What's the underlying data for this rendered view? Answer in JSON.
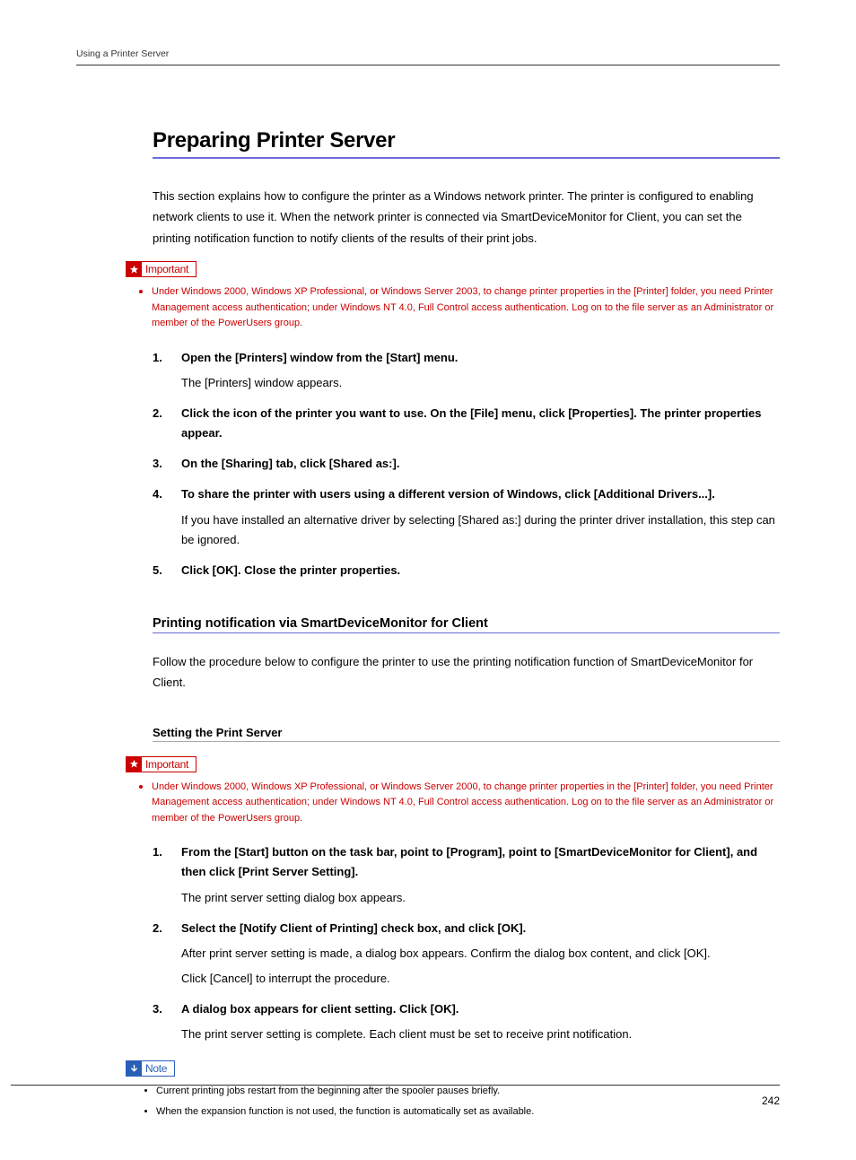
{
  "running_head": "Using a Printer Server",
  "page_number": "242",
  "title": "Preparing Printer Server",
  "intro": "This section explains how to configure the printer as a Windows network printer. The printer is configured to enabling network clients to use it. When the network printer is connected via SmartDeviceMonitor for Client, you can set the printing notification function to notify clients of the results of their print jobs.",
  "important_label": "Important",
  "note_label": "Note",
  "important1_text": "Under Windows 2000, Windows XP Professional, or Windows Server 2003, to change printer properties in the [Printer] folder, you need Printer Management access authentication; under Windows NT 4.0, Full Control access authentication. Log on to the file server as an Administrator or member of the PowerUsers group.",
  "steps1": [
    {
      "bold": "Open the [Printers] window from the [Start] menu.",
      "desc": "The [Printers] window appears."
    },
    {
      "bold": "Click the icon of the printer you want to use. On the [File] menu, click [Properties]. The printer properties appear.",
      "desc": ""
    },
    {
      "bold": "On the [Sharing] tab, click [Shared as:].",
      "desc": ""
    },
    {
      "bold": "To share the printer with users using a different version of Windows, click [Additional Drivers...].",
      "desc": "If you have installed an alternative driver by selecting [Shared as:] during the printer driver installation, this step can be ignored."
    },
    {
      "bold": "Click [OK]. Close the printer properties.",
      "desc": ""
    }
  ],
  "sub_heading": "Printing notification via SmartDeviceMonitor for Client",
  "sub_intro": "Follow the procedure below to configure the printer to use the printing notification function of SmartDeviceMonitor for Client.",
  "sub_sub_heading": "Setting the Print Server",
  "important2_text": "Under Windows 2000, Windows XP Professional, or Windows Server 2000, to change printer properties in the [Printer] folder, you need Printer Management access authentication; under Windows NT 4.0, Full Control access authentication. Log on to the file server as an Administrator or member of the PowerUsers group.",
  "steps2": [
    {
      "bold": "From the [Start] button on the task bar, point to [Program], point to [SmartDeviceMonitor for Client], and then click [Print Server Setting].",
      "desc": "The print server setting dialog box appears."
    },
    {
      "bold": "Select the [Notify Client of Printing] check box, and click [OK].",
      "desc": "After print server setting is made, a dialog box appears. Confirm the dialog box content, and click [OK].",
      "desc2": "Click [Cancel] to interrupt the procedure."
    },
    {
      "bold": "A dialog box appears for client setting. Click [OK].",
      "desc": "The print server setting is complete. Each client must be set to receive print notification."
    }
  ],
  "notes": [
    "Current printing jobs restart from the beginning after the spooler pauses briefly.",
    "When the expansion function is not used, the function is automatically set as available."
  ]
}
